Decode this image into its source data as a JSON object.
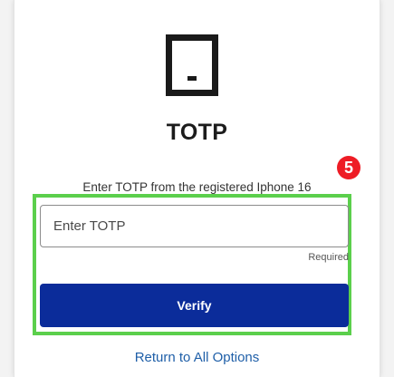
{
  "header": {
    "icon": "mobile-device-icon",
    "title": "TOTP"
  },
  "instruction": "Enter TOTP from the registered Iphone 16",
  "annotation": {
    "step_number": "5",
    "badge_color": "#ee1c25",
    "highlight_color": "#5bcf4c"
  },
  "form": {
    "totp_input": {
      "placeholder": "Enter TOTP",
      "value": ""
    },
    "required_label": "Required",
    "verify_label": "Verify",
    "verify_color": "#0b2c9a"
  },
  "footer": {
    "return_link": "Return to All Options",
    "link_color": "#1f5fa8"
  }
}
